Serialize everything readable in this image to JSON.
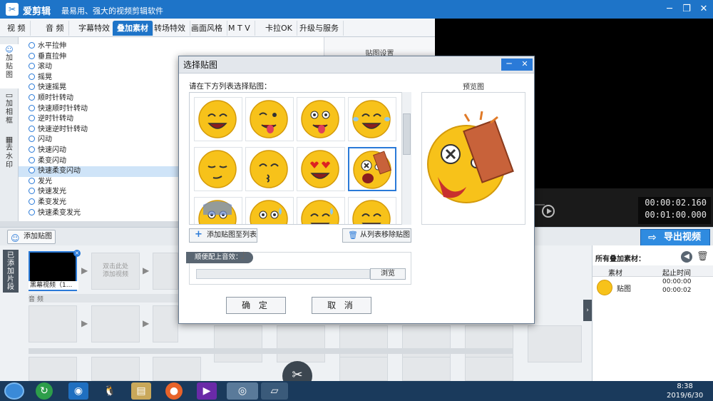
{
  "app": {
    "title": "爱剪辑",
    "subtitle": "最易用、强大的视频剪辑软件",
    "logo_icon": "app-logo-icon"
  },
  "tabs": [
    "视 频",
    "音 频",
    "字幕特效",
    "叠加素材",
    "转场特效",
    "画面风格",
    "M T V",
    "卡拉OK",
    "升级与服务"
  ],
  "active_tab": 3,
  "left_tabs": [
    {
      "label": "加\n贴\n图",
      "icon": "sticker-icon"
    },
    {
      "label": "加\n相\n框",
      "icon": "frame-icon"
    },
    {
      "label": "去\n水\n印",
      "icon": "watermark-icon"
    }
  ],
  "effects": [
    "水平拉伸",
    "垂直拉伸",
    "滚动",
    "摇晃",
    "快速摇晃",
    "顺时针转动",
    "快速顺时针转动",
    "逆时针转动",
    "快速逆时针转动",
    "闪动",
    "快速闪动",
    "柔变闪动",
    "快速柔变闪动",
    "发光",
    "快速发光",
    "柔变发光",
    "快速柔变发光"
  ],
  "selected_effect": 12,
  "settings_header": "贴图设置",
  "time": {
    "current": "00:00:02.160",
    "total": "00:01:00.000"
  },
  "toolbar": {
    "add_sticker": "添加贴图",
    "export": "导出视频"
  },
  "timeline": {
    "label": "已\n添\n加\n片\n段",
    "black_clip": "黑幕视频（1...",
    "add_hint": "双击此处\n添加视频",
    "audio_label": "音 频"
  },
  "right_panel": {
    "header": "所有叠加素材：",
    "col_material": "素材",
    "col_time": "起止时间",
    "row_name": "贴图",
    "row_start": "00:00:00",
    "row_end": "00:00:02"
  },
  "dialog": {
    "title": "选择贴图",
    "instruction": "请在下方列表选择贴图：",
    "preview_label": "预览图",
    "add_btn": "添加贴图至列表",
    "remove_btn": "从列表移除贴图",
    "sound_label": "顺便配上音效：",
    "browse_btn": "浏览",
    "ok_btn": "确 定",
    "cancel_btn": "取 消",
    "minimize_icon": "minimize-icon",
    "close_icon": "close-icon",
    "stickers": [
      "grin",
      "tongue-wink",
      "tongue-crazy",
      "laughing-tears",
      "smirk",
      "kiss",
      "heart-eyes",
      "brick-hit",
      "shocked",
      "sweat",
      "sweat-smile",
      "smile"
    ],
    "selected_sticker": 7
  },
  "clock": {
    "time": "8:38",
    "date": "2019/6/30"
  },
  "colors": {
    "accent": "#1e74c8",
    "selection": "#cfe4f8",
    "emoji": "#f7c21a"
  }
}
